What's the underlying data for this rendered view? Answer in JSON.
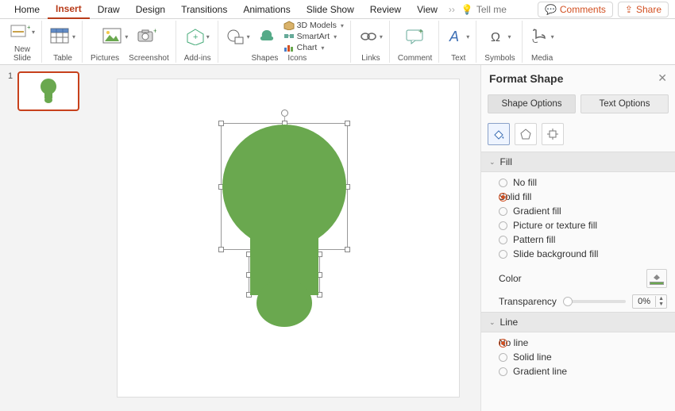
{
  "tabs": [
    "Home",
    "Insert",
    "Draw",
    "Design",
    "Transitions",
    "Animations",
    "Slide Show",
    "Review",
    "View"
  ],
  "tell_me": "Tell me",
  "comments_label": "Comments",
  "share_label": "Share",
  "ribbon": {
    "new_slide": "New\nSlide",
    "table": "Table",
    "pictures": "Pictures",
    "screenshot": "Screenshot",
    "addins": "Add-ins",
    "shapes": "Shapes",
    "icons": "Icons",
    "models": "3D Models",
    "smartart": "SmartArt",
    "chart": "Chart",
    "links": "Links",
    "comment": "Comment",
    "text": "Text",
    "symbols": "Symbols",
    "media": "Media"
  },
  "thumb_number": "1",
  "panel": {
    "title": "Format Shape",
    "seg_shape": "Shape Options",
    "seg_text": "Text Options",
    "sec_fill": "Fill",
    "sec_line": "Line",
    "fill_opts": [
      "No fill",
      "Solid fill",
      "Gradient fill",
      "Picture or texture fill",
      "Pattern fill",
      "Slide background fill"
    ],
    "fill_selected": 1,
    "line_opts": [
      "No line",
      "Solid line",
      "Gradient line"
    ],
    "line_selected": 0,
    "color_label": "Color",
    "transparency_label": "Transparency",
    "transparency_value": "0%"
  },
  "shape_color": "#6aa84f"
}
